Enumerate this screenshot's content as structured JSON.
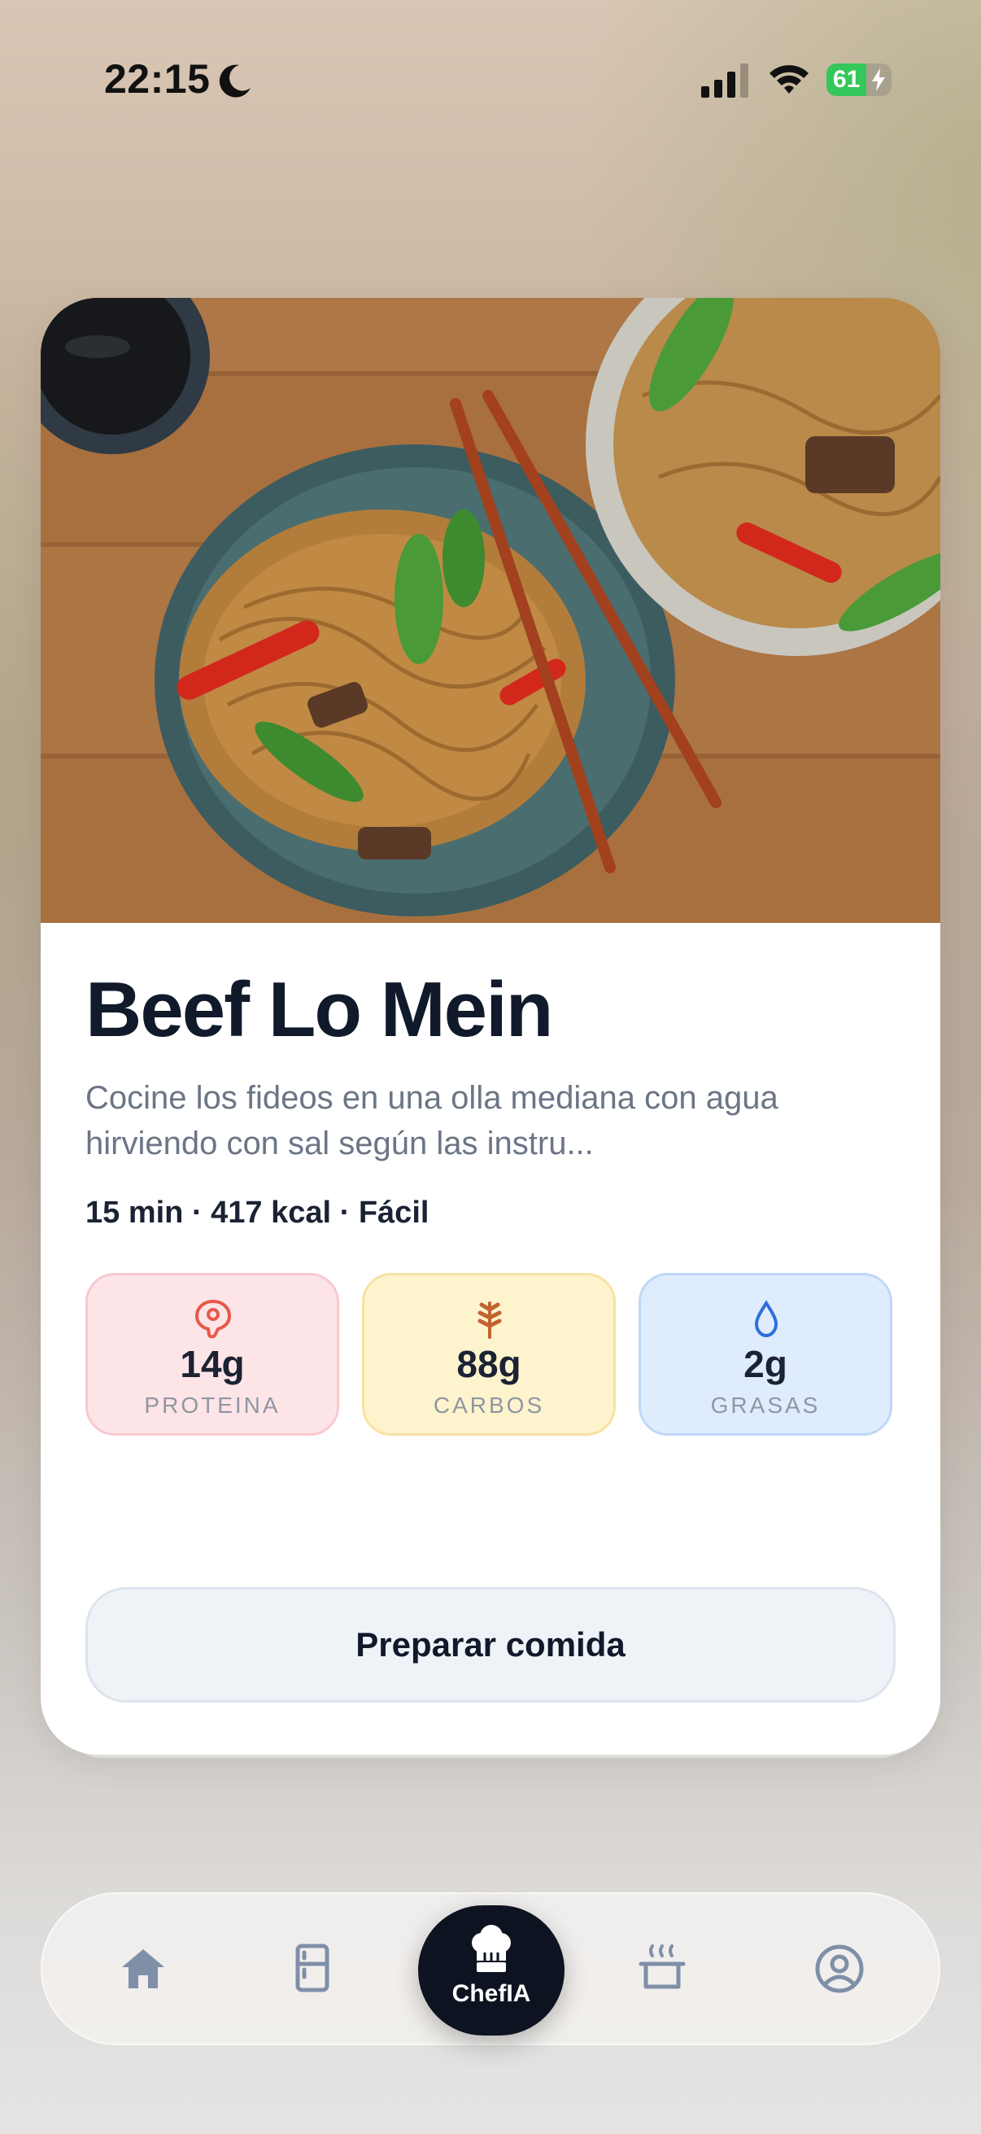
{
  "status_bar": {
    "time": "22:15",
    "battery": "61",
    "battery_level": 0.61,
    "icons": [
      "moon-icon",
      "signal-icon",
      "wifi-icon",
      "battery-icon"
    ]
  },
  "recipe": {
    "title": "Beef Lo Mein",
    "description": "Cocine los fideos en una olla mediana con agua hirviendo con sal según las instru...",
    "meta": "15 min · 417 kcal · Fácil",
    "image_icon": "beef-lo-mein-photo",
    "macros": [
      {
        "value": "14g",
        "label": "PROTEINA",
        "icon": "meat-icon",
        "color": "#e8584a",
        "bg": "#fde4e6"
      },
      {
        "value": "88g",
        "label": "CARBOS",
        "icon": "wheat-icon",
        "color": "#c2622f",
        "bg": "#fdf3cd"
      },
      {
        "value": "2g",
        "label": "GRASAS",
        "icon": "drop-icon",
        "color": "#2f6fdb",
        "bg": "#dfecfd"
      }
    ],
    "action_label": "Preparar comida"
  },
  "tab_bar": {
    "items": [
      {
        "icon": "home-icon"
      },
      {
        "icon": "fridge-icon"
      },
      {
        "icon": "chef-hat-icon",
        "label": "ChefIA"
      },
      {
        "icon": "cooking-pot-icon"
      },
      {
        "icon": "profile-icon"
      }
    ],
    "active_color": "#0d1320",
    "inactive_color": "#7f8fa8"
  }
}
